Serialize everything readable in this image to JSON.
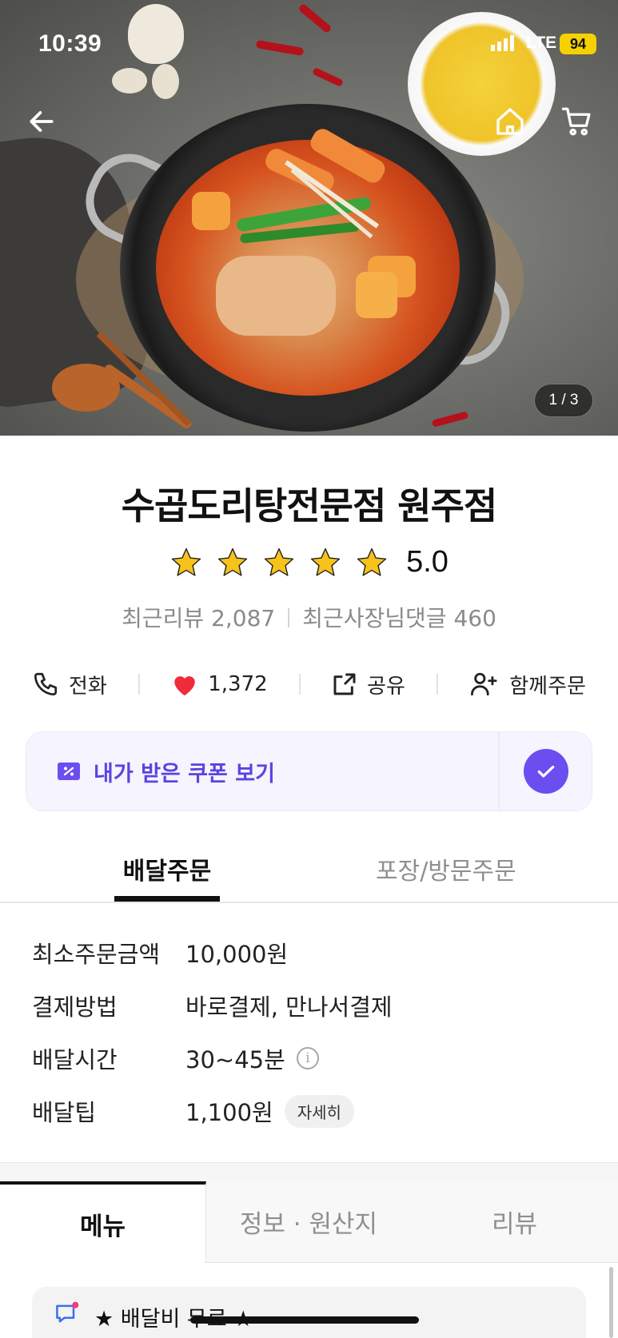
{
  "status_bar": {
    "time": "10:39",
    "network": "LTE",
    "battery": "94"
  },
  "hero": {
    "image_counter": "1 / 3"
  },
  "store": {
    "name": "수곱도리탕전문점 원주점",
    "rating": "5.0",
    "rating_stars": 5,
    "recent_reviews": "최근리뷰 2,087",
    "owner_replies": "최근사장님댓글 460"
  },
  "actions": {
    "call": "전화",
    "likes": "1,372",
    "share": "공유",
    "group_order": "함께주문"
  },
  "coupon": {
    "label": "내가 받은 쿠폰 보기"
  },
  "order_tabs": {
    "delivery": "배달주문",
    "pickup": "포장/방문주문"
  },
  "info": [
    {
      "key": "최소주문금액",
      "value": "10,000원"
    },
    {
      "key": "결제방법",
      "value": "바로결제, 만나서결제"
    },
    {
      "key": "배달시간",
      "value": "30~45분"
    },
    {
      "key": "배달팁",
      "value": "1,100원",
      "chip": "자세히"
    }
  ],
  "menu_tabs": {
    "menu": "메뉴",
    "info": "정보 · 원산지",
    "review": "리뷰"
  },
  "notice": {
    "text": "★ 배달비 무료 ★"
  },
  "colors": {
    "accent": "#6b4ef0",
    "coupon_text": "#5a44e0",
    "star": "#f7c21a",
    "heart": "#ef2b3c"
  }
}
